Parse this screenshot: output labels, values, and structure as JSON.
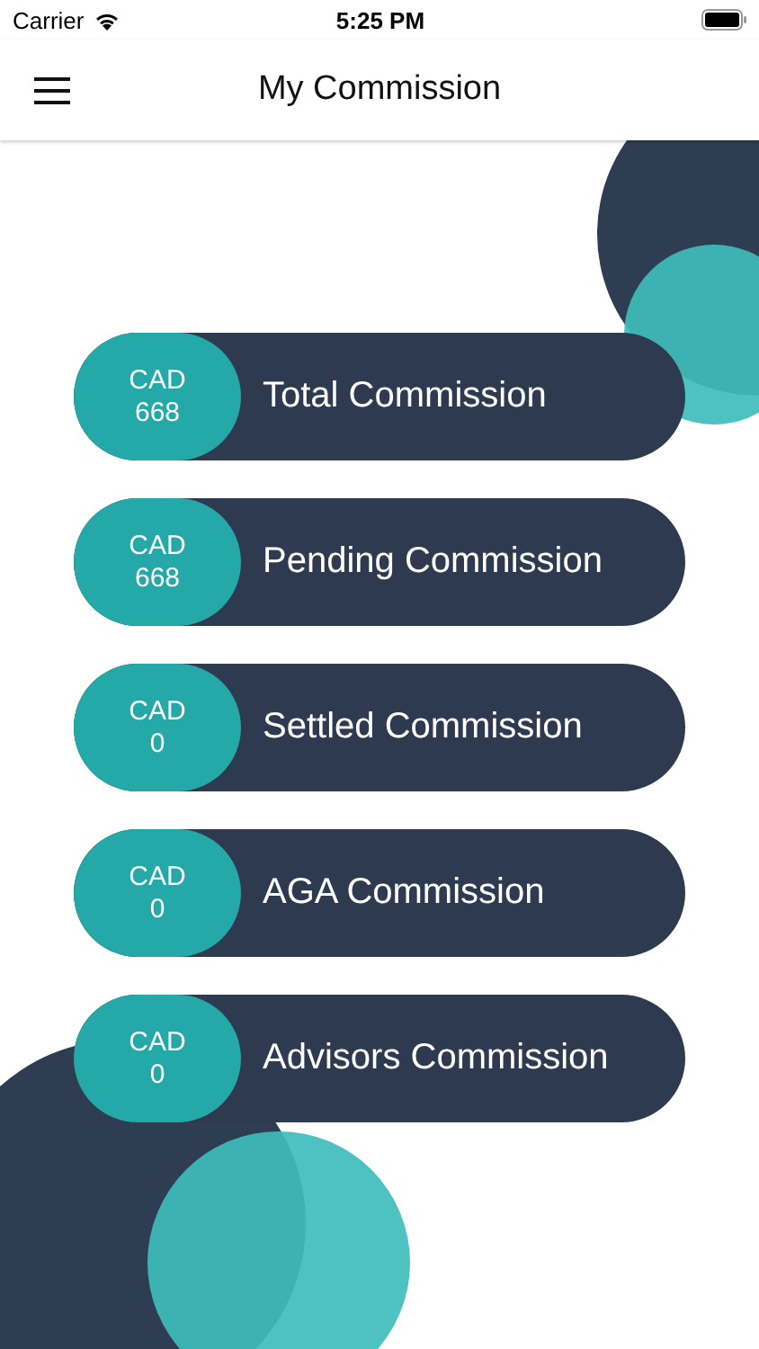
{
  "status_bar": {
    "carrier": "Carrier",
    "time": "5:25 PM"
  },
  "nav_bar": {
    "title": "My Commission"
  },
  "commissions": [
    {
      "currency": "CAD",
      "amount": "668",
      "label": "Total Commission"
    },
    {
      "currency": "CAD",
      "amount": "668",
      "label": "Pending Commission"
    },
    {
      "currency": "CAD",
      "amount": "0",
      "label": "Settled Commission"
    },
    {
      "currency": "CAD",
      "amount": "0",
      "label": "AGA Commission"
    },
    {
      "currency": "CAD",
      "amount": "0",
      "label": "Advisors Commission"
    }
  ]
}
